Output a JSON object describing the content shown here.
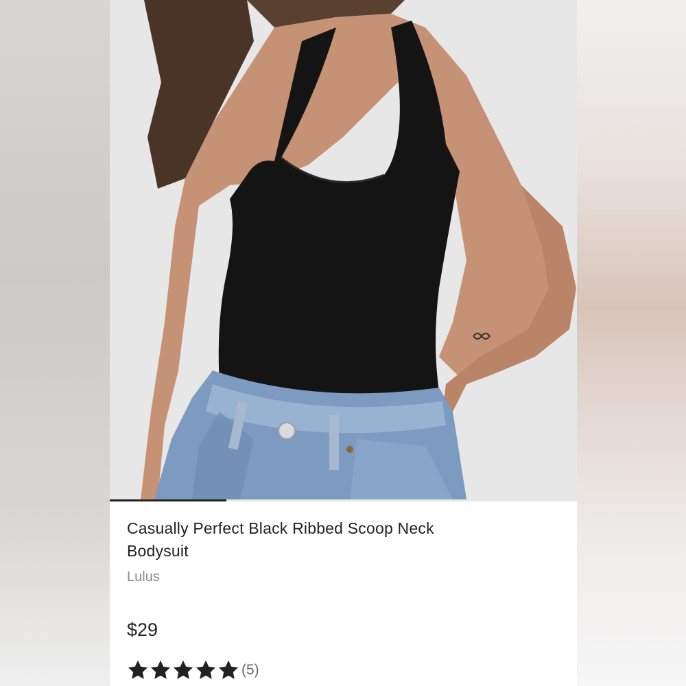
{
  "product": {
    "title_line1": "Casually Perfect Black Ribbed Scoop Neck",
    "title_line2": "Bodysuit",
    "brand": "Lulus",
    "price": "$29",
    "rating": {
      "stars": 5,
      "max_stars": 5,
      "review_count": "(5)"
    }
  },
  "gallery": {
    "progress_fraction": 0.25,
    "image_subject": "product-photo"
  },
  "colors": {
    "text_primary": "#222222",
    "text_secondary": "#8a8a8a",
    "star": "#222222"
  }
}
